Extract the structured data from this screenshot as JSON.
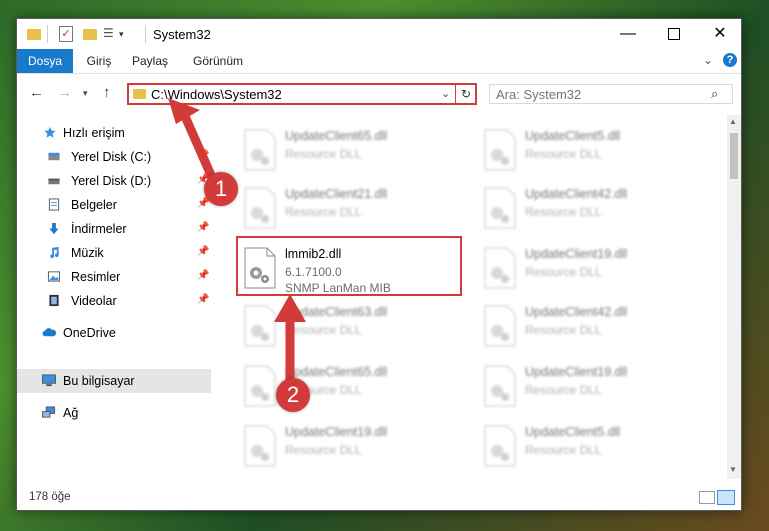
{
  "window": {
    "title": "System32"
  },
  "ribbon": {
    "tabs": [
      {
        "label": "Dosya"
      },
      {
        "label": "Giriş"
      },
      {
        "label": "Paylaş"
      },
      {
        "label": "Görünüm"
      }
    ],
    "accent": "#1979ca"
  },
  "address": {
    "path": "C:\\Windows\\System32"
  },
  "search": {
    "placeholder": "Ara: System32"
  },
  "sidebar": {
    "items": [
      {
        "label": "Hızlı erişim"
      },
      {
        "label": "Yerel Disk (C:)"
      },
      {
        "label": "Yerel Disk (D:)"
      },
      {
        "label": "Belgeler"
      },
      {
        "label": "İndirmeler"
      },
      {
        "label": "Müzik"
      },
      {
        "label": "Resimler"
      },
      {
        "label": "Videolar"
      },
      {
        "label": "OneDrive"
      },
      {
        "label": "Bu bilgisayar"
      },
      {
        "label": "Ağ"
      }
    ],
    "selected": "Bu bilgisayar"
  },
  "files": {
    "background_left": [
      {
        "name": "UpdateClient65.dll",
        "desc": "Resource DLL"
      },
      {
        "name": "UpdateClient21.dll",
        "desc": "Resource DLL"
      },
      {
        "name": "UpdateClient63.dll",
        "desc": "Resource DLL"
      },
      {
        "name": "UpdateClient65.dll",
        "desc": "Resource DLL"
      },
      {
        "name": "UpdateClient19.dll",
        "desc": "Resource DLL"
      }
    ],
    "background_right": [
      {
        "name": "UpdateClient5.dll",
        "desc": "Resource DLL"
      },
      {
        "name": "UpdateClient42.dll",
        "desc": "Resource DLL"
      },
      {
        "name": "UpdateClient19.dll",
        "desc": "Resource DLL"
      },
      {
        "name": "UpdateClient42.dll",
        "desc": "Resource DLL"
      },
      {
        "name": "UpdateClient19.dll",
        "desc": "Resource DLL"
      },
      {
        "name": "UpdateClient5.dll",
        "desc": "Resource DLL"
      }
    ],
    "highlighted": {
      "name": "lmmib2.dll",
      "version": "6.1.7100.0",
      "desc": "SNMP LanMan MIB"
    }
  },
  "status": {
    "count": "178 öğe"
  },
  "annotations": {
    "step1": "1",
    "step2": "2",
    "color": "#d33a3a"
  }
}
